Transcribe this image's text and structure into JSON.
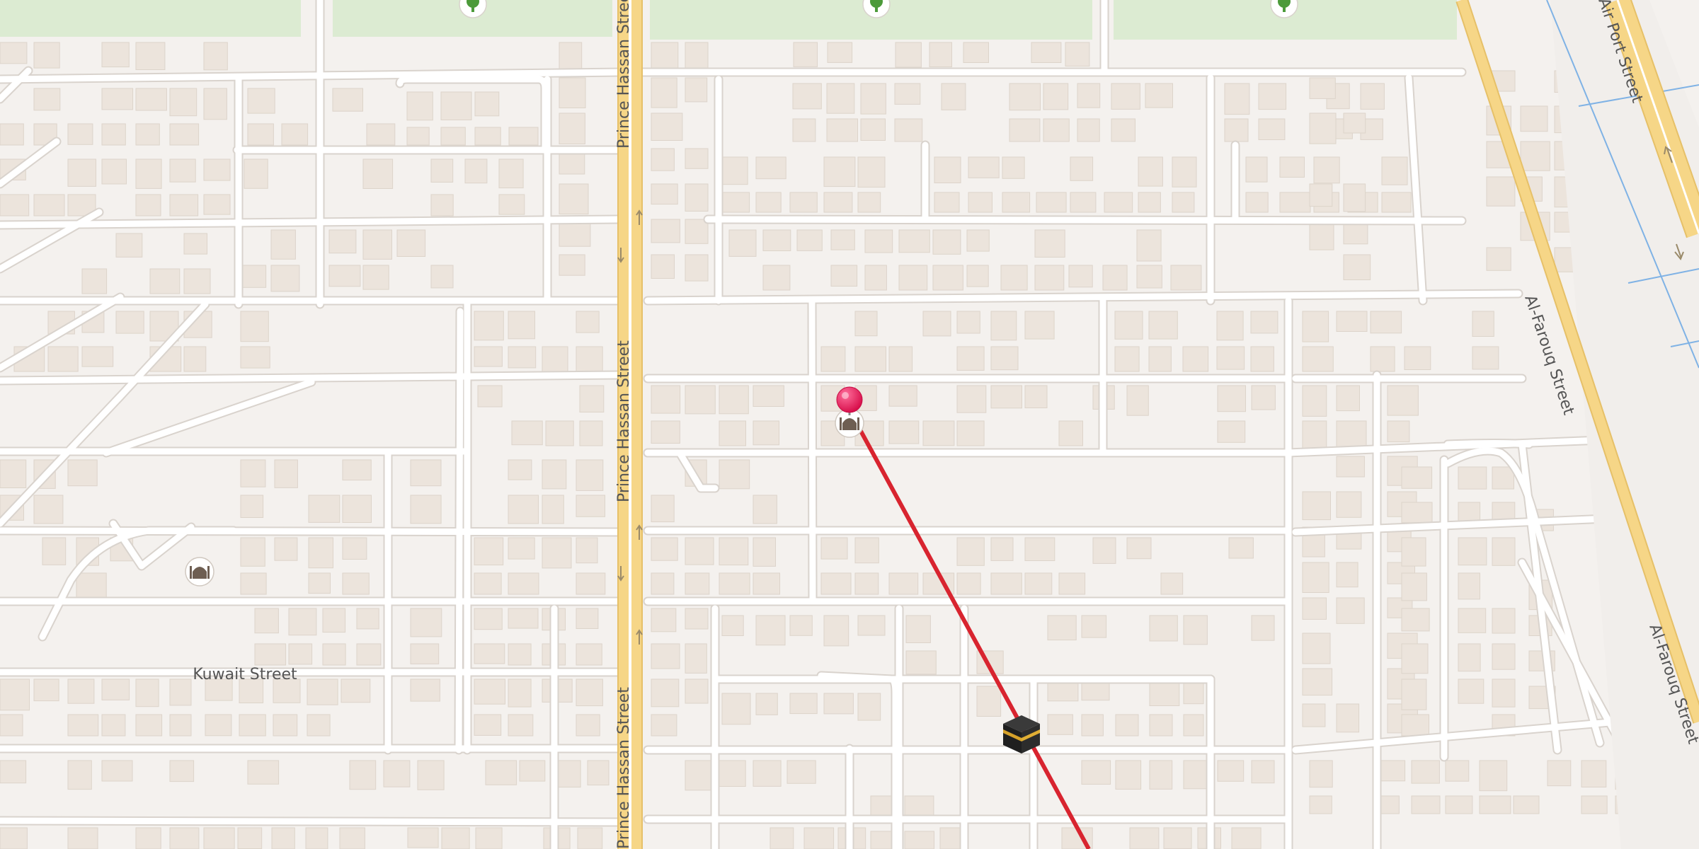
{
  "map": {
    "street_labels": {
      "prince_hassan_1": "Prince Hassan Street",
      "prince_hassan_2": "Prince Hassan Street",
      "prince_hassan_3": "Prince Hassan Street",
      "kuwait": "Kuwait Street",
      "al_farouq_1": "Al-Farouq Street",
      "al_farouq_2": "Al-Farouq Street",
      "airport": "Air Port Street"
    },
    "icons": {
      "user_location_pin": "map-pin",
      "mosque_near_pin": "mosque",
      "mosque_west": "mosque",
      "kaaba": "kaaba",
      "parks": "tree"
    },
    "colors": {
      "background": "#f4f1ee",
      "building": "#ece4dc",
      "main_road": "#f5d580",
      "park": "#dcebd2",
      "qibla_line": "#d8242f",
      "pin": "#e8185a",
      "water": "#7fb2e5"
    }
  }
}
